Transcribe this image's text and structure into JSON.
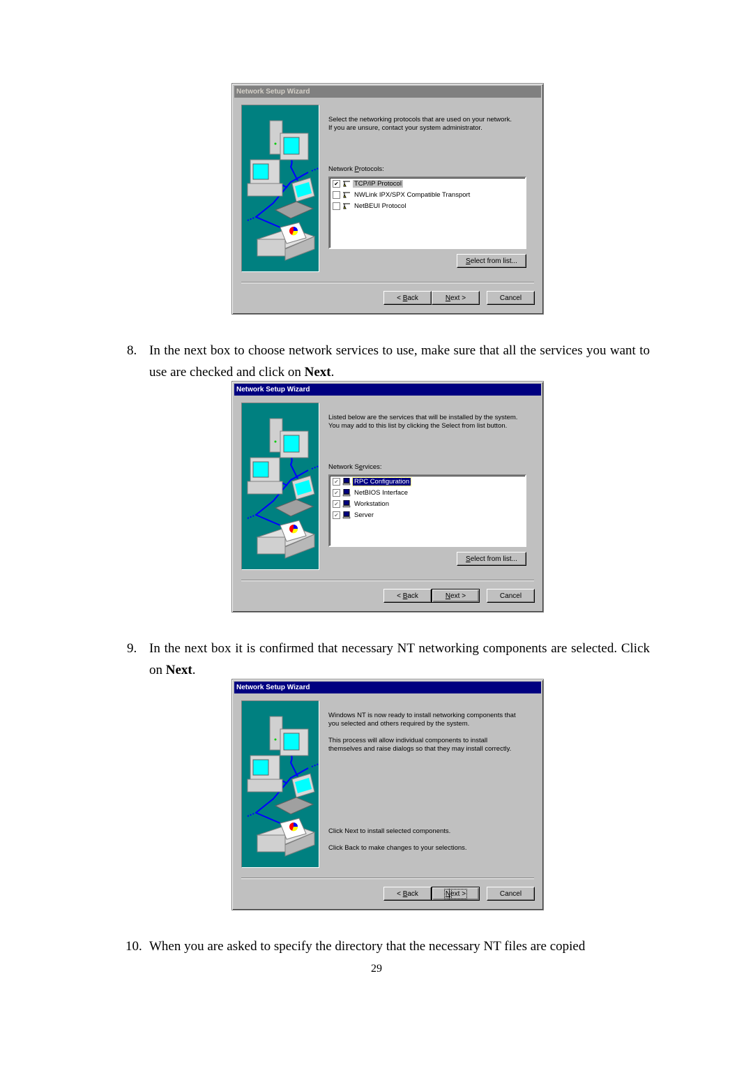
{
  "document": {
    "page_number": "29",
    "steps": [
      {
        "number": "8.",
        "text": "In the next box to choose network services to use, make sure that all the services you want to use are checked and click on ",
        "bold": "Next",
        "tail": "."
      },
      {
        "number": "9.",
        "text": "In the next box it is confirmed that necessary NT networking components are selected. Click on ",
        "bold": "Next",
        "tail": "."
      },
      {
        "number": "10.",
        "text": "When you are asked to specify the directory that the necessary NT files are copied",
        "bold": "",
        "tail": ""
      }
    ]
  },
  "dialogs": [
    {
      "title": "Network Setup Wizard",
      "title_state": "inactive",
      "intro_lines": [
        "Select the networking protocols that are used on your network.",
        "If you are unsure, contact your system administrator."
      ],
      "list_label_pre": "Network ",
      "list_label_key": "P",
      "list_label_post": "rotocols:",
      "items": [
        {
          "label": "TCP/IP Protocol",
          "checked": true,
          "icon": "protocol-icon",
          "selected": true
        },
        {
          "label": "NWLink IPX/SPX Compatible Transport",
          "checked": false,
          "icon": "protocol-icon",
          "selected": false
        },
        {
          "label": "NetBEUI Protocol",
          "checked": false,
          "icon": "protocol-icon",
          "selected": false
        }
      ],
      "select_button": {
        "key": "S",
        "rest": "elect from list..."
      },
      "back_button": {
        "pre": "< ",
        "key": "B",
        "rest": "ack"
      },
      "next_button": {
        "pre": "",
        "key": "N",
        "rest": "ext >"
      },
      "cancel_button": "Cancel"
    },
    {
      "title": "Network Setup Wizard",
      "title_state": "active",
      "intro_lines": [
        "Listed below are the services that will be installed by the system.",
        "You may add to this list by clicking the Select from list button."
      ],
      "list_label_pre": "Network S",
      "list_label_key": "e",
      "list_label_post": "rvices:",
      "items": [
        {
          "label": "RPC Configuration",
          "checked": true,
          "icon": "service-icon",
          "selected": true
        },
        {
          "label": "NetBIOS Interface",
          "checked": true,
          "icon": "service-icon",
          "selected": false
        },
        {
          "label": "Workstation",
          "checked": true,
          "icon": "service-icon",
          "selected": false
        },
        {
          "label": "Server",
          "checked": true,
          "icon": "service-icon",
          "selected": false
        }
      ],
      "select_button": {
        "key": "S",
        "rest": "elect from list..."
      },
      "back_button": {
        "pre": "< ",
        "key": "B",
        "rest": "ack"
      },
      "next_button": {
        "pre": "",
        "key": "N",
        "rest": "ext >"
      },
      "cancel_button": "Cancel"
    },
    {
      "title": "Network Setup Wizard",
      "title_state": "active",
      "intro_lines": [
        "Windows NT is now ready to install networking components that",
        "you selected and others required by the system."
      ],
      "intro2_lines": [
        "This process will allow individual components to install",
        "themselves and raise dialogs so that they may install correctly."
      ],
      "footer_lines": [
        "Click Next to install selected components.",
        "Click Back to make changes to your selections."
      ],
      "back_button": {
        "pre": "< ",
        "key": "B",
        "rest": "ack"
      },
      "next_button": {
        "pre": "",
        "key": "N",
        "rest": "ext >"
      },
      "cancel_button": "Cancel"
    }
  ]
}
